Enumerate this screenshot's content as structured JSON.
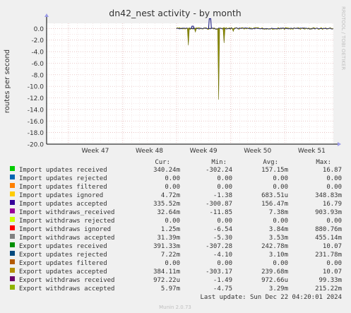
{
  "chart_data": {
    "type": "line",
    "title": "dn42_nest activity - by month",
    "ylabel": "routes per second",
    "watermark": "RRDTOOL / TOBI OETIKER",
    "footer": "Munin 2.0.73",
    "ylim": [
      -20,
      1
    ],
    "y_ticks": [
      0.0,
      -2.0,
      -4.0,
      -6.0,
      -8.0,
      -10.0,
      -12.0,
      -14.0,
      -16.0,
      -18.0,
      -20.0
    ],
    "y_tick_labels": [
      "0.0",
      "-2.0",
      "-4.0",
      "-6.0",
      "-8.0",
      "-10.0",
      "-12.0",
      "-14.0",
      "-16.0",
      "-18.0",
      "-20.0"
    ],
    "x_ticks": [
      "Week 47",
      "Week 48",
      "Week 49",
      "Week 50",
      "Week 51"
    ],
    "x_tick_positions": [
      47,
      48,
      49,
      50,
      51
    ],
    "xlim": [
      46.6,
      51.9
    ],
    "grid": true,
    "colors": {
      "background": "#f0f0f0",
      "plot_area": "#ffffff",
      "grid": "#e0b0b0",
      "axis": "#000000",
      "zero_line": "#000000",
      "arrow": "#9a9ae6",
      "spike_olive": "#8c8c00",
      "dark_line": "#1a1a80",
      "title": "#333333",
      "text": "#333333",
      "watermark": "#c0c0c0"
    },
    "activity_start": 49.0,
    "activity_end": 51.9,
    "series": [
      {
        "name": "Import updates received",
        "color": "#00cc00"
      },
      {
        "name": "Import updates rejected",
        "color": "#0066b3"
      },
      {
        "name": "Import updates filtered",
        "color": "#ff8000"
      },
      {
        "name": "Import updates ignored",
        "color": "#ffcc00"
      },
      {
        "name": "Import updates accepted",
        "color": "#330099"
      },
      {
        "name": "Import withdraws_received",
        "color": "#990099"
      },
      {
        "name": "Import withdraws rejected",
        "color": "#ccff00"
      },
      {
        "name": "Import withdraws ignored",
        "color": "#ff0000"
      },
      {
        "name": "Import withdraws accepted",
        "color": "#808080"
      },
      {
        "name": "Export updates received",
        "color": "#008f00"
      },
      {
        "name": "Export updates rejected",
        "color": "#00487d"
      },
      {
        "name": "Export updates filtered",
        "color": "#b35a00"
      },
      {
        "name": "Export updates accepted",
        "color": "#b38f00"
      },
      {
        "name": "Export withdraws received",
        "color": "#6b006b"
      },
      {
        "name": "Export withdraws accepted",
        "color": "#8fb300"
      }
    ],
    "spikes": [
      {
        "x": 49.22,
        "y": -2.9
      },
      {
        "x": 49.78,
        "y": -12.3
      },
      {
        "x": 49.88,
        "y": -2.5
      },
      {
        "x": 49.35,
        "y": -0.6
      },
      {
        "x": 50.05,
        "y": -0.5
      }
    ],
    "peaks": [
      {
        "x": 49.62,
        "y": 1.7
      },
      {
        "x": 49.3,
        "y": 0.4
      }
    ],
    "legend_headers": [
      "Cur:",
      "Min:",
      "Avg:",
      "Max:"
    ],
    "legend_rows": [
      {
        "label": "Import updates received",
        "cur": "340.24m",
        "min": "-302.24",
        "avg": "157.15m",
        "max": "16.87"
      },
      {
        "label": "Import updates rejected",
        "cur": "0.00",
        "min": "0.00",
        "avg": "0.00",
        "max": "0.00"
      },
      {
        "label": "Import updates filtered",
        "cur": "0.00",
        "min": "0.00",
        "avg": "0.00",
        "max": "0.00"
      },
      {
        "label": "Import updates ignored",
        "cur": "4.72m",
        "min": "-1.38",
        "avg": "683.51u",
        "max": "348.83m"
      },
      {
        "label": "Import updates accepted",
        "cur": "335.52m",
        "min": "-300.87",
        "avg": "156.47m",
        "max": "16.79"
      },
      {
        "label": "Import withdraws_received",
        "cur": "32.64m",
        "min": "-11.85",
        "avg": "7.38m",
        "max": "903.93m"
      },
      {
        "label": "Import withdraws rejected",
        "cur": "0.00",
        "min": "0.00",
        "avg": "0.00",
        "max": "0.00"
      },
      {
        "label": "Import withdraws ignored",
        "cur": "1.25m",
        "min": "-6.54",
        "avg": "3.84m",
        "max": "880.76m"
      },
      {
        "label": "Import withdraws accepted",
        "cur": "31.39m",
        "min": "-5.30",
        "avg": "3.53m",
        "max": "455.14m"
      },
      {
        "label": "Export updates received",
        "cur": "391.33m",
        "min": "-307.28",
        "avg": "242.78m",
        "max": "10.07"
      },
      {
        "label": "Export updates rejected",
        "cur": "7.22m",
        "min": "-4.10",
        "avg": "3.10m",
        "max": "231.78m"
      },
      {
        "label": "Export updates filtered",
        "cur": "0.00",
        "min": "0.00",
        "avg": "0.00",
        "max": "0.00"
      },
      {
        "label": "Export updates accepted",
        "cur": "384.11m",
        "min": "-303.17",
        "avg": "239.68m",
        "max": "10.07"
      },
      {
        "label": "Export withdraws received",
        "cur": "972.22u",
        "min": "-1.49",
        "avg": "972.66u",
        "max": "99.33m"
      },
      {
        "label": "Export withdraws accepted",
        "cur": "5.97m",
        "min": "-4.75",
        "avg": "3.29m",
        "max": "215.22m"
      }
    ],
    "last_update": "Last update:  Sun Dec 22 04:20:01 2024"
  }
}
